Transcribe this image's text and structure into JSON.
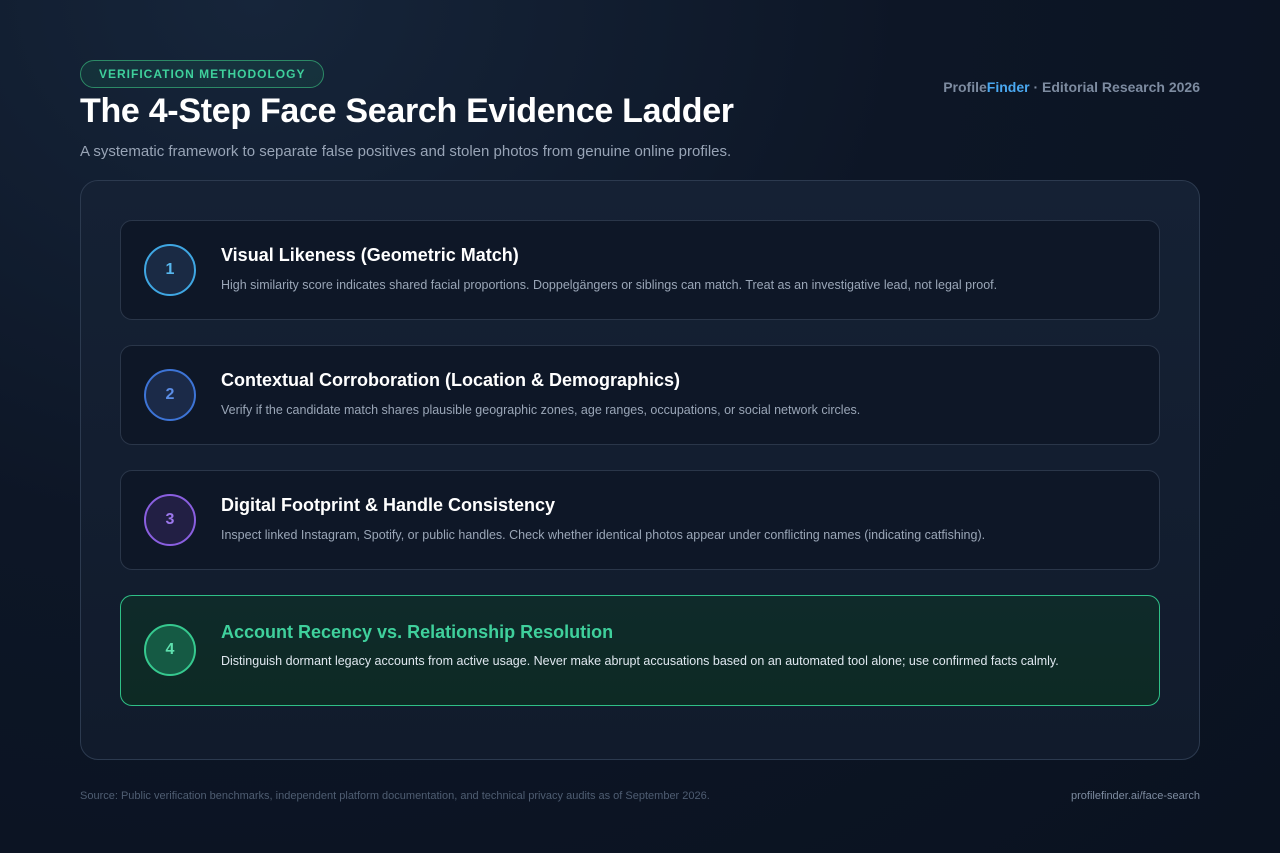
{
  "header": {
    "badge": "VERIFICATION METHODOLOGY",
    "brand_part1": "Profile",
    "brand_part2": "Finder",
    "brand_suffix": " · Editorial Research 2026",
    "title": "The 4-Step Face Search Evidence Ladder",
    "subtitle": "A systematic framework to separate false positives and stolen photos from genuine online profiles."
  },
  "steps": [
    {
      "number": "1",
      "title": "Visual Likeness (Geometric Match)",
      "description": "High similarity score indicates shared facial proportions. Doppelgängers or siblings can match. Treat as an investigative lead, not legal proof."
    },
    {
      "number": "2",
      "title": "Contextual Corroboration (Location & Demographics)",
      "description": "Verify if the candidate match shares plausible geographic zones, age ranges, occupations, or social network circles."
    },
    {
      "number": "3",
      "title": "Digital Footprint & Handle Consistency",
      "description": "Inspect linked Instagram, Spotify, or public handles. Check whether identical photos appear under conflicting names (indicating catfishing)."
    },
    {
      "number": "4",
      "title": "Account Recency vs. Relationship Resolution",
      "description": "Distinguish dormant legacy accounts from active usage. Never make abrupt accusations based on an automated tool alone; use confirmed facts calmly."
    }
  ],
  "footer": {
    "source": "Source: Public verification benchmarks, independent platform documentation, and technical privacy audits as of September 2026.",
    "url": "profilefinder.ai/face-search"
  },
  "colors": {
    "accent_green": "#3fd09c",
    "accent_blue": "#4aa8f0",
    "step1": "#3fa7e3",
    "step2": "#3d74d6",
    "step3": "#8a5fe0",
    "step4": "#36c98f"
  }
}
